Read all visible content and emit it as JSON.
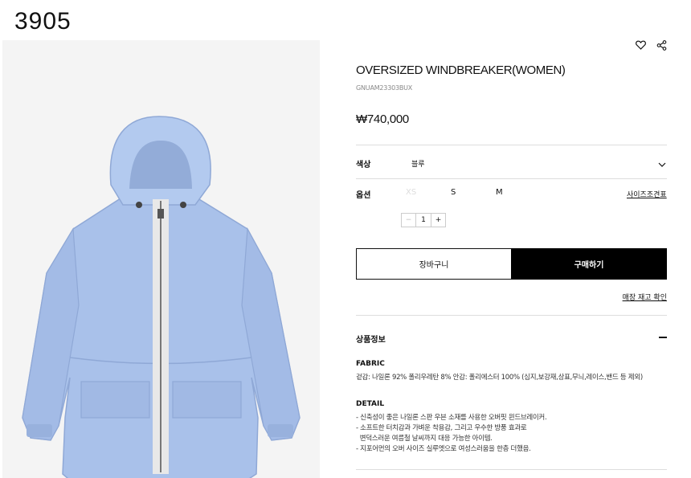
{
  "page_code": "3905",
  "product": {
    "title": "OVERSIZED WINDBREAKER(WOMEN)",
    "sku": "GNUAM23303BUX",
    "price": "₩740,000",
    "image_alt": "jacket-photo"
  },
  "options": {
    "color_label": "색상",
    "color_value": "블루",
    "option_label": "옵션",
    "sizes": [
      "XS",
      "S",
      "M"
    ],
    "size_guide": "사이즈조견표",
    "quantity": "1",
    "minus": "−",
    "plus": "+"
  },
  "actions": {
    "cart": "장바구니",
    "buy": "구매하기",
    "stock_check": "매장 재고 확인"
  },
  "info": {
    "title": "상품정보",
    "fabric_title": "FABRIC",
    "fabric_text": "겉감: 나일론 92% 폴리우레탄 8% 안감: 폴리에스터 100% (심지,보강재,상표,무늬,레이스,밴드 등 제외)",
    "detail_title": "DETAIL",
    "detail_lines": [
      "- 신축성이 좋은 나일론 스판 우븐 소재를 사용한 오버핏 윈드브레이커.",
      "- 소프트한 터치감과 가벼운 착용감, 그리고 우수한 방풍 효과로",
      "  변덕스러운 여름철 날씨까지 대응 가능한 아이템.",
      "- 지포어먼의 오버 사이즈 실루엣으로 여성스러움을 한층 더했음."
    ]
  },
  "colors": {
    "jacket": "#a9c1ea",
    "jacket_shade": "#8fa8d6",
    "zipper": "#e8e8e8"
  }
}
